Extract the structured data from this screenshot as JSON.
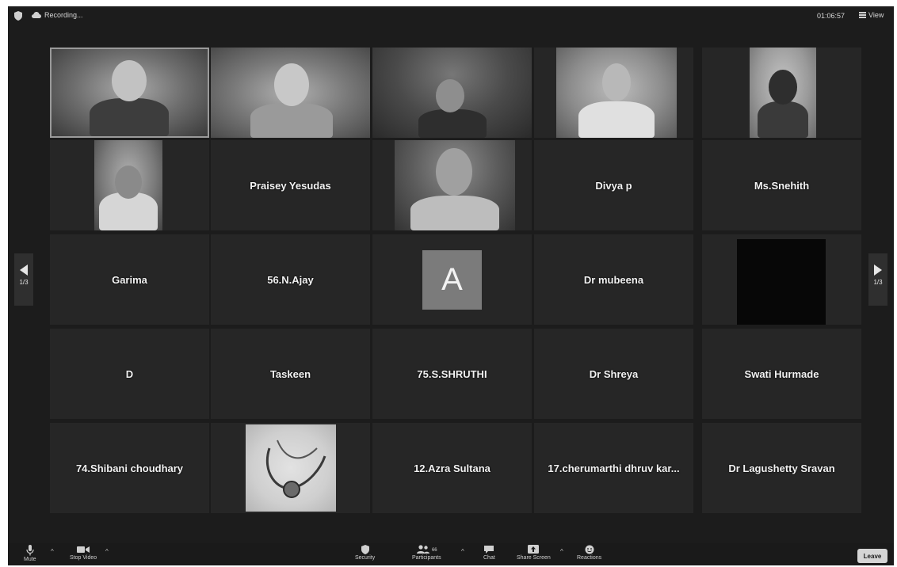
{
  "topbar": {
    "recording_label": "Recording...",
    "timer": "01:06:57",
    "view_label": "View"
  },
  "participants": {
    "row2": [
      "Praisey Yesudas",
      "Divya p",
      "Ms.Snehith"
    ],
    "row3": [
      "Garima",
      "56.N.Ajay",
      "Dr mubeena"
    ],
    "row4": [
      "D",
      "Taskeen",
      "75.S.SHRUTHI",
      "Dr Shreya",
      "Swati Hurmade"
    ],
    "row5": [
      "74.Shibani choudhary",
      "12.Azra Sultana",
      "17.cherumarthi dhruv kar...",
      "Dr Lagushetty Sravan"
    ],
    "avatar_letter": "A"
  },
  "pager": {
    "left_label": "1/3",
    "right_label": "1/3"
  },
  "toolbar": {
    "mute": "Mute",
    "stop_video": "Stop Video",
    "security": "Security",
    "participants": "Participants",
    "participants_count": "66",
    "chat": "Chat",
    "share_screen": "Share Screen",
    "reactions": "Reactions",
    "leave": "Leave"
  },
  "colors": {
    "background": "#1c1c1c",
    "tile": "#262626",
    "text": "#f2f2f2"
  }
}
